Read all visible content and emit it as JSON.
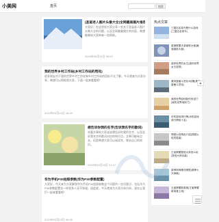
{
  "header": {
    "logo": "小美网",
    "nav_home": "首页",
    "search_placeholder": "",
    "search_button": "搜索"
  },
  "articles": [
    {
      "title": "(圣诞老人图片头像大全)全网最美图片推荐",
      "excerpt": "大家好，在这里给大家分享一些关于圣诞老人图片头像大全的问题，以及全网最美图片的内容，希望能够给大家带来一些帮助。",
      "date": "2024年03月11日 05:03"
    },
    {
      "title": "我的世界乡村工作站(乡村工作站的用处)",
      "excerpt": "很多朋友对于我的世界乡村工作站和乡村工作站的用处不太了解，今天就来为大家分享，希望可以帮助到大家，下面一起来看看吧！",
      "date": "2024年03月10日 18:23"
    },
    {
      "title": "想告诉你我的名字(告诉我名字的歌词)",
      "excerpt": "本篇文章给大家谈谈想告诉你我的名字，以及告诉我名字的歌词对应的知识点，文章可能有点长，但是希望大家可以阅读完，增长自己的知识。",
      "date": "2024年03月10日 13:12"
    },
    {
      "title": "华为手机P30拍照参数(华为P30参数配置)",
      "excerpt": "大家好，今天来为大家解答华为手机P30拍照参数这个问题的一些问题点，包括华为P30参数配置也一样很多人还不知道，因此呢，今天就来为大家分析分析，现在让我们一起来看看吧！",
      "date": "2024年03月10日 06:20"
    }
  ],
  "sidebar": {
    "title": "热点文章",
    "items": [
      {
        "text": "三国志名将令是什么游戏(三国志名将令)"
      },
      {
        "text": "英雄联盟手游钢铁大使(最强钢铁大使)"
      },
      {
        "text": "迷你世界的女王(迷你世界女王皮肤)"
      },
      {
        "text": "奥特曼格斗进化3攻略(奥特曼格斗进化)"
      },
      {
        "text": "我的世界如何制作传送门(我的世界地狱门)"
      },
      {
        "text": "手机游戏排行榜(手机游戏排行榜前十名)"
      },
      {
        "text": "穿越火线角色介绍(穿越火线灵狐者)"
      },
      {
        "text": "王者荣耀鲁班大师怎么玩(鲁班大师出装)"
      },
      {
        "text": "原神风神像在哪里(原神七天神像)"
      },
      {
        "text": "王者荣耀新英雄(王者荣耀新英雄上线)"
      }
    ]
  },
  "colors": {
    "accent": "#4c7fd1",
    "bg": "#f2f2f2"
  }
}
